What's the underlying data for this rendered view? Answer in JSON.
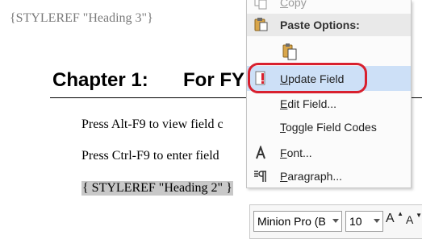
{
  "document": {
    "header_field": "{STYLEREF \"Heading 3\"}",
    "chapter_number": "Chapter 1:",
    "chapter_title": "For FY",
    "paragraphs": [
      "Press Alt-F9 to view field c",
      "Press Ctrl-F9 to enter field",
      "{ STYLEREF \"Heading 2\" }"
    ]
  },
  "context_menu": {
    "copy": {
      "prefix": "",
      "key": "C",
      "rest": "opy"
    },
    "paste_options": "Paste Options:",
    "update_field": {
      "prefix": "",
      "key": "U",
      "rest": "pdate Field"
    },
    "edit_field": {
      "prefix": "",
      "key": "E",
      "rest": "dit Field..."
    },
    "toggle_field_codes": {
      "prefix": "",
      "key": "T",
      "rest": "oggle Field Codes"
    },
    "font": {
      "prefix": "",
      "key": "F",
      "rest": "ont..."
    },
    "paragraph": {
      "prefix": "",
      "key": "P",
      "rest": "aragraph..."
    }
  },
  "mini_toolbar": {
    "font_name": "Minion Pro (B",
    "font_size": "10",
    "grow_label": "A",
    "shrink_label": "A"
  },
  "icons": {
    "copy": "copy-icon",
    "paste_options": "clipboard-icon",
    "keep_text_only": "paste-text-only-icon",
    "update_field": "update-field-icon",
    "font": "font-icon",
    "paragraph": "paragraph-icon"
  },
  "colors": {
    "selection_highlight": "#cde0f7",
    "annotation_ring": "#d8202e",
    "field_shading": "#c8c8c8"
  }
}
